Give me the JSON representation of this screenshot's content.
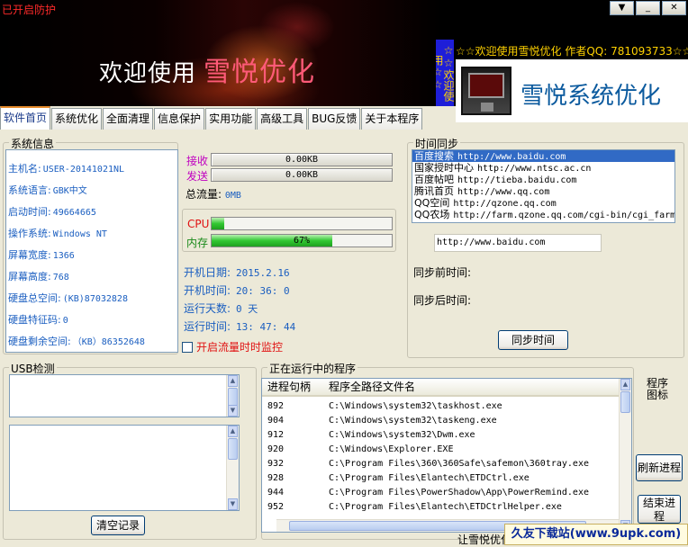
{
  "header": {
    "protect_status": "已开启防护",
    "welcome_prefix": "欢迎使用",
    "app_name": "雪悦优化",
    "marquee_text": "☆☆欢迎使用雪悦优化 作者QQ: 781093733☆☆",
    "vertical_marquee": "☆☆欢迎使用☆☆",
    "logo_title": "雪悦系统优化",
    "window_buttons": [
      "▼",
      "_",
      "✕"
    ]
  },
  "tabs": [
    "软件首页",
    "系统优化",
    "全面清理",
    "信息保护",
    "实用功能",
    "高级工具",
    "BUG反馈",
    "关于本程序"
  ],
  "active_tab": 0,
  "system_info": {
    "title": "系统信息",
    "rows": [
      {
        "label": "主机名:",
        "value": "USER-20141021NL"
      },
      {
        "label": "系统语言:",
        "value": "GBK中文"
      },
      {
        "label": "启动时间:",
        "value": "49664665"
      },
      {
        "label": "操作系统:",
        "value": "Windows NT"
      },
      {
        "label": "屏幕宽度:",
        "value": "1366"
      },
      {
        "label": "屏幕高度:",
        "value": "768"
      },
      {
        "label": "硬盘总空间:",
        "value": "(KB)87032828"
      },
      {
        "label": "硬盘特征码:",
        "value": "0"
      },
      {
        "label": "硬盘剩余空间:",
        "value": "（KB）86352648"
      }
    ]
  },
  "traffic": {
    "receive_label": "接收",
    "receive_value": "0.00KB",
    "send_label": "发送",
    "send_value": "0.00KB",
    "total_label": "总流量:",
    "total_value": "0MB",
    "receive_color": "#c000c0",
    "send_color": "#c000c0"
  },
  "usage": {
    "cpu_label": "CPU",
    "cpu_fraction": 0.07,
    "mem_label": "内存",
    "mem_fraction": 0.67,
    "mem_text": "67%",
    "cpu_color": "#e01010",
    "mem_color": "#1a8a1a"
  },
  "uptime": {
    "rows": [
      {
        "label": "开机日期:",
        "value": "2015.2.16"
      },
      {
        "label": "开机时间:",
        "value": "20: 36: 0"
      },
      {
        "label": "运行天数:",
        "value": "0 天"
      },
      {
        "label": "运行时间:",
        "value": "13: 47: 44"
      }
    ],
    "monitor_label": "开启流量时时监控"
  },
  "time_sync": {
    "title": "时间同步",
    "servers": [
      {
        "name": "百度搜索",
        "url": "http://www.baidu.com"
      },
      {
        "name": "国家授时中心",
        "url": "http://www.ntsc.ac.cn"
      },
      {
        "name": "百度帖吧",
        "url": "http://tieba.baidu.com"
      },
      {
        "name": "腾讯首页",
        "url": "http://www.qq.com"
      },
      {
        "name": "QQ空间",
        "url": "http://qzone.qq.com"
      },
      {
        "name": "QQ农场",
        "url": "http://farm.qzone.qq.com/cgi-bin/cgi_farm"
      }
    ],
    "selected_index": 0,
    "url_value": "http://www.baidu.com",
    "before_label": "同步前时间:",
    "after_label": "同步后时间:",
    "sync_button": "同步时间"
  },
  "usb": {
    "title": "USB检测",
    "clear_button": "清空记录"
  },
  "processes": {
    "title": "正在运行中的程序",
    "columns": [
      "进程句柄",
      "程序全路径文件名"
    ],
    "rows": [
      {
        "pid": "892",
        "path": "C:\\Windows\\system32\\taskhost.exe"
      },
      {
        "pid": "904",
        "path": "C:\\Windows\\system32\\taskeng.exe"
      },
      {
        "pid": "912",
        "path": "C:\\Windows\\system32\\Dwm.exe"
      },
      {
        "pid": "920",
        "path": "C:\\Windows\\Explorer.EXE"
      },
      {
        "pid": "932",
        "path": "C:\\Program Files\\360\\360Safe\\safemon\\360tray.exe"
      },
      {
        "pid": "928",
        "path": "C:\\Program Files\\Elantech\\ETDCtrl.exe"
      },
      {
        "pid": "944",
        "path": "C:\\Program Files\\PowerShadow\\App\\PowerRemind.exe"
      },
      {
        "pid": "952",
        "path": "C:\\Program Files\\Elantech\\ETDCtrlHelper.exe"
      }
    ],
    "icon_label": "程序图标",
    "refresh_button": "刷新进程",
    "end_button": "结束进程"
  },
  "footer": {
    "marquee": "让雪悦优化",
    "watermark": "久友下载站(www.9upk.com)"
  }
}
